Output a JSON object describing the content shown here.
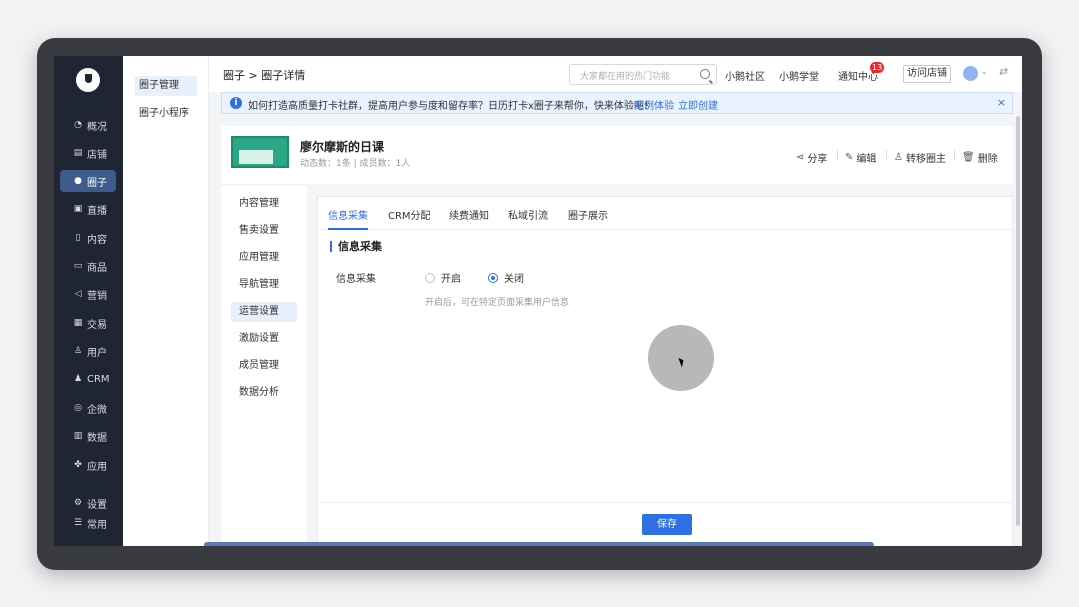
{
  "nav": {
    "items": [
      {
        "icon": "overview-icon",
        "glyph": "◔",
        "label": "概况"
      },
      {
        "icon": "store-icon",
        "glyph": "▤",
        "label": "店铺"
      },
      {
        "icon": "circle-icon",
        "glyph": "●",
        "label": "圈子",
        "active": true
      },
      {
        "icon": "live-icon",
        "glyph": "▣",
        "label": "直播"
      },
      {
        "icon": "content-icon",
        "glyph": "▯",
        "label": "内容"
      },
      {
        "icon": "product-icon",
        "glyph": "▭",
        "label": "商品"
      },
      {
        "icon": "marketing-icon",
        "glyph": "◁",
        "label": "营销"
      },
      {
        "icon": "trade-icon",
        "glyph": "▦",
        "label": "交易"
      },
      {
        "icon": "user-icon",
        "glyph": "♙",
        "label": "用户"
      },
      {
        "icon": "crm-icon",
        "glyph": "♟",
        "label": "CRM"
      },
      {
        "icon": "wecom-icon",
        "glyph": "◎",
        "label": "企微"
      },
      {
        "icon": "data-icon",
        "glyph": "▥",
        "label": "数据"
      },
      {
        "icon": "apps-icon",
        "glyph": "✤",
        "label": "应用"
      },
      {
        "icon": "settings-icon",
        "glyph": "⚙",
        "label": "设置"
      },
      {
        "icon": "common-icon",
        "glyph": "☰",
        "label": "常用"
      }
    ]
  },
  "subnav": {
    "items": [
      "圈子管理",
      "圈子小程序"
    ]
  },
  "topbar": {
    "breadcrumb": "圈子 > 圈子详情",
    "search_placeholder": "大家都在用的热门功能",
    "links": [
      "小鹅社区",
      "小鹅学堂",
      "通知中心"
    ],
    "notice_count": "13",
    "visit_store": "访问店铺"
  },
  "notice": {
    "text": "如何打造高质量打卡社群，提高用户参与度和留存率？日历打卡x圈子来帮你，快来体验吧！",
    "link1": "案例体验",
    "link2": "立即创建"
  },
  "circle": {
    "title": "廖尔摩斯的日课",
    "meta": "动态数：1条  |  成员数：1人",
    "actions": [
      "分享",
      "编辑",
      "转移圈主",
      "删除"
    ]
  },
  "leftmenu": {
    "items": [
      "内容管理",
      "售卖设置",
      "应用管理",
      "导航管理",
      "运营设置",
      "激励设置",
      "成员管理",
      "数据分析"
    ],
    "active_index": 4
  },
  "tabs": [
    "信息采集",
    "CRM分配",
    "续费通知",
    "私域引流",
    "圈子展示"
  ],
  "section": {
    "title": "信息采集",
    "field_label": "信息采集",
    "option_on": "开启",
    "option_off": "关闭",
    "selected": "关闭",
    "hint": "开启后，可在特定页面采集用户信息"
  },
  "save_label": "保存",
  "colors": {
    "accent": "#2f6fe4",
    "sidebar": "#1f2533",
    "badge": "#f5222d"
  }
}
